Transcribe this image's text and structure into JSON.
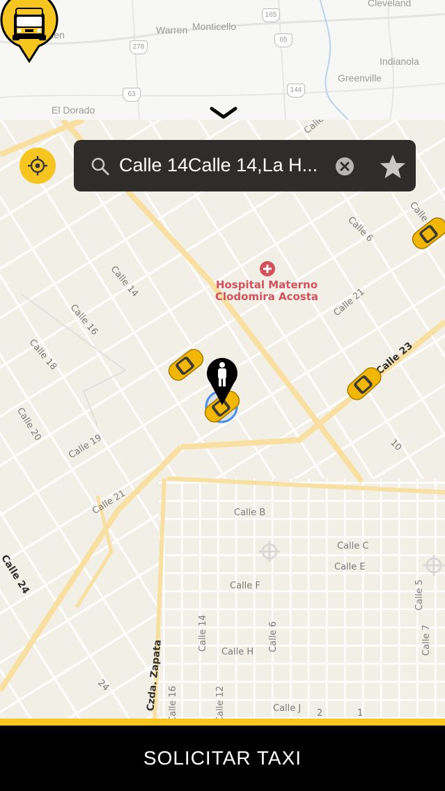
{
  "top_map": {
    "labels": {
      "camden": "Camden",
      "warren": "Warren",
      "monticello": "Monticello",
      "cleveland": "Cleveland",
      "indianola": "Indianola",
      "greenville": "Greenville",
      "el_dorado": "El Dorado"
    },
    "shields": {
      "s165": "165",
      "s278": "278",
      "s65": "65",
      "s144": "144",
      "s63": "63"
    }
  },
  "search": {
    "value": "Calle 14Calle 14,La H...",
    "icon": "search-icon",
    "clear_icon": "clear-icon",
    "favorite_icon": "star-icon"
  },
  "map": {
    "poi": {
      "name_line1": "Hospital Materno",
      "name_line2": "Clodomira Acosta"
    },
    "streets": {
      "c14": "Calle 14",
      "c16": "Calle 16",
      "c18": "Calle 18",
      "c20": "Calle 20",
      "c19": "Calle 19",
      "c21_a": "Calle 21",
      "c21_b": "Calle 21",
      "c6": "Calle 6",
      "c23": "Calle 23",
      "c24": "Calle 24",
      "calle_top": "Calle",
      "calle_top2": "Calle",
      "n10": "10",
      "n24": "24",
      "cb": "Calle B",
      "cc": "Calle C",
      "ce": "Calle E",
      "cf": "Calle F",
      "ch": "Calle H",
      "cj": "Calle J",
      "c5": "Calle 5",
      "c7": "Calle 7",
      "c6v": "Calle 6",
      "c12": "Calle 12",
      "c14v": "Calle 14",
      "c16v": "Calle 16",
      "zapata": "Czda. Zapata",
      "n2": "2",
      "n1": "1"
    }
  },
  "colors": {
    "accent": "#f7c520",
    "search_bg": "#2e2d2b",
    "map_bg": "#f2efe6",
    "major_road": "#f9dfa0",
    "poi": "#d4515c",
    "user_marker": "#000000",
    "location_ring": "#4a8ee8"
  },
  "bottom": {
    "request_label": "SOLICITAR TAXI"
  }
}
